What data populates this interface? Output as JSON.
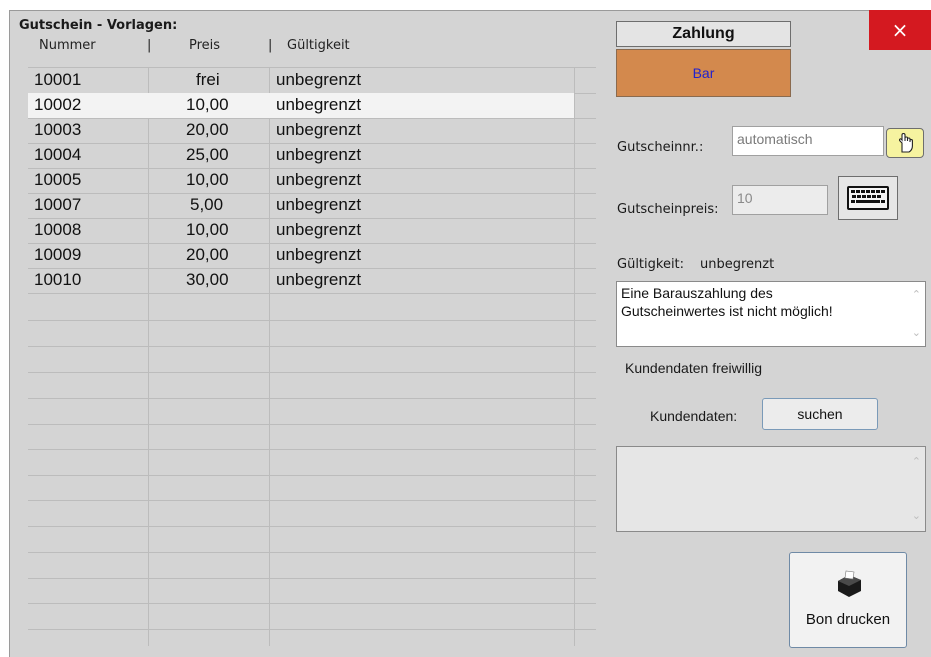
{
  "grid": {
    "title": "Gutschein - Vorlagen:",
    "headers": {
      "nummer": "Nummer",
      "sep1": "|",
      "preis": "Preis",
      "sep2": "|",
      "gueltigkeit": "Gültigkeit"
    },
    "rows": [
      {
        "nummer": "10001",
        "preis": "frei",
        "gueltigkeit": "unbegrenzt"
      },
      {
        "nummer": "10002",
        "preis": "10,00",
        "gueltigkeit": "unbegrenzt"
      },
      {
        "nummer": "10003",
        "preis": "20,00",
        "gueltigkeit": "unbegrenzt"
      },
      {
        "nummer": "10004",
        "preis": "25,00",
        "gueltigkeit": "unbegrenzt"
      },
      {
        "nummer": "10005",
        "preis": "10,00",
        "gueltigkeit": "unbegrenzt"
      },
      {
        "nummer": "10007",
        "preis": "5,00",
        "gueltigkeit": "unbegrenzt"
      },
      {
        "nummer": "10008",
        "preis": "10,00",
        "gueltigkeit": "unbegrenzt"
      },
      {
        "nummer": "10009",
        "preis": "20,00",
        "gueltigkeit": "unbegrenzt"
      },
      {
        "nummer": "10010",
        "preis": "30,00",
        "gueltigkeit": "unbegrenzt"
      }
    ],
    "selected_row": "10002"
  },
  "payment": {
    "header": "Zahlung",
    "method": "Bar",
    "accent_color": "#d3894d"
  },
  "window": {
    "close_label": "×",
    "close_color": "#d41920"
  },
  "form": {
    "gutscheinnr_label": "Gutscheinnr.:",
    "gutscheinnr_value": "automatisch",
    "gutscheinpreis_label": "Gutscheinpreis:",
    "gutscheinpreis_value": "10",
    "gueltigkeit_label": "Gültigkeit:",
    "gueltigkeit_value": "unbegrenzt",
    "hint_line1": "Eine Barauszahlung des",
    "hint_line2": "Gutscheinwertes ist nicht möglich!",
    "kundendaten_note": "Kundendaten freiwillig",
    "kundendaten_label": "Kundendaten:",
    "suchen_label": "suchen",
    "print_label": "Bon drucken"
  },
  "icons": {
    "hand": "pointing-hand-icon",
    "keyboard": "keyboard-icon",
    "printer": "receipt-printer-icon",
    "close": "close-icon"
  }
}
